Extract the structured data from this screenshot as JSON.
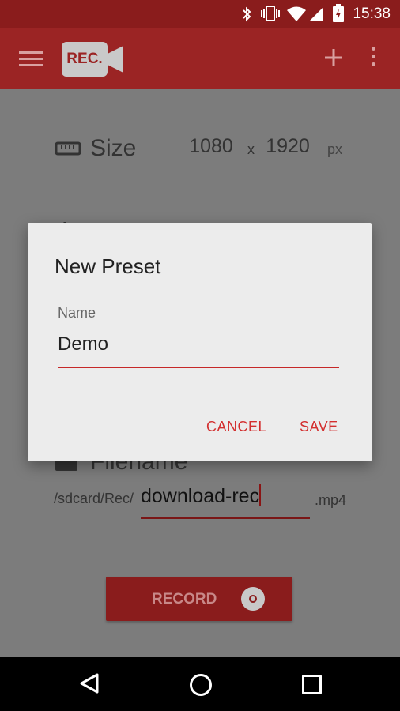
{
  "status_bar": {
    "time": "15:38",
    "icons": [
      "bluetooth-icon",
      "vibrate-icon",
      "wifi-icon",
      "signal-icon",
      "battery-icon"
    ]
  },
  "app_bar": {
    "logo_text": "REC.",
    "actions": [
      "add-icon",
      "more-vert-icon"
    ]
  },
  "settings": {
    "size_label": "Size",
    "width_value": "1080",
    "height_value": "1920",
    "separator": "x",
    "unit": "px",
    "filename_label": "Filename",
    "path_prefix": "/sdcard/Rec/",
    "filename_value": "download-rec",
    "extension": ".mp4",
    "record_label": "RECORD"
  },
  "dialog": {
    "title": "New Preset",
    "name_label": "Name",
    "name_value": "Demo",
    "cancel_label": "CANCEL",
    "save_label": "SAVE"
  },
  "colors": {
    "primary": "#9b2424",
    "primary_dark": "#8a1c1c",
    "accent": "#d32f2f",
    "dialog_bg": "#ececec"
  }
}
